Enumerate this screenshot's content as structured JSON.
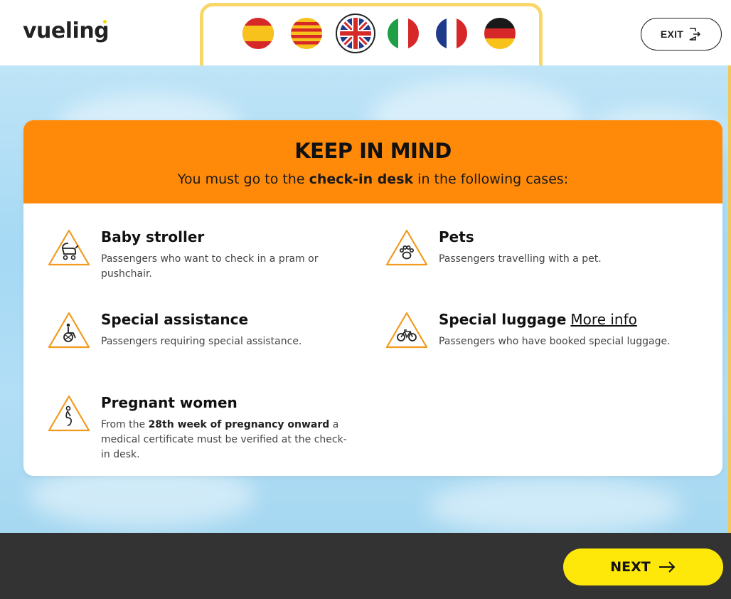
{
  "header": {
    "logo_text": "vueling",
    "logo_dot_color": "#f5d90a",
    "languages": [
      {
        "code": "es",
        "name": "Spanish",
        "icon": "spain-flag-icon",
        "selected": false
      },
      {
        "code": "ca",
        "name": "Catalan",
        "icon": "catalonia-flag-icon",
        "selected": false
      },
      {
        "code": "en",
        "name": "English",
        "icon": "uk-flag-icon",
        "selected": true
      },
      {
        "code": "it",
        "name": "Italian",
        "icon": "italy-flag-icon",
        "selected": false
      },
      {
        "code": "fr",
        "name": "French",
        "icon": "france-flag-icon",
        "selected": false
      },
      {
        "code": "de",
        "name": "German",
        "icon": "germany-flag-icon",
        "selected": false
      }
    ],
    "exit_label": "EXIT",
    "exit_icon": "exit-icon"
  },
  "card": {
    "title": "KEEP IN MIND",
    "subtitle_prefix": "You must go to the ",
    "subtitle_bold": "check-in desk",
    "subtitle_suffix": " in the following cases:",
    "header_color": "#ff8a0a",
    "cases": [
      {
        "title": "Baby stroller",
        "desc": "Passengers who want to check in a pram or pushchair.",
        "icon": "stroller-warning-icon"
      },
      {
        "title": "Pets",
        "desc": "Passengers travelling with a pet.",
        "icon": "paw-warning-icon"
      },
      {
        "title": "Special assistance",
        "desc": "Passengers requiring special assistance.",
        "icon": "wheelchair-warning-icon"
      },
      {
        "title": "Special luggage",
        "link": "More info",
        "desc": "Passengers who have booked special luggage.",
        "icon": "bicycle-warning-icon"
      },
      {
        "title": "Pregnant women",
        "desc_prefix": "From the ",
        "desc_bold": "28th week of pregnancy onward",
        "desc_suffix": " a medical certificate must be verified at the check-in desk.",
        "icon": "pregnant-warning-icon"
      }
    ]
  },
  "footer": {
    "next_label": "NEXT",
    "next_icon": "arrow-right-icon",
    "next_color": "#fde80a"
  }
}
